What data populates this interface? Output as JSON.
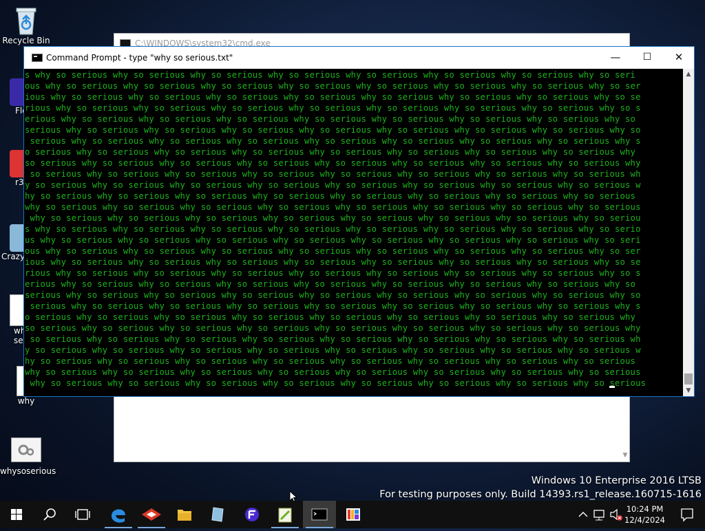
{
  "desktop": {
    "icons": [
      {
        "label": "Recycle Bin"
      },
      {
        "label": "Flo"
      },
      {
        "label": "r3"
      },
      {
        "label": "Crazy"
      },
      {
        "label": "wh"
      },
      {
        "label": "ser"
      },
      {
        "label": "why"
      },
      {
        "label": "whysoserious"
      }
    ]
  },
  "back_window": {
    "title": "C:\\WINDOWS\\system32\\cmd.exe"
  },
  "cmd_window": {
    "title": "Command Prompt - type  \"why so serious.txt\"",
    "controls": {
      "minimize": "—",
      "maximize": "☐",
      "close": "✕"
    },
    "console_lines": [
      "s why so serious why so serious why so serious why so serious why so serious why so serious why so serious why so seri",
      "ous why so serious why so serious why so serious why so serious why so serious why so serious why so serious why so ser",
      "ious why so serious why so serious why so serious why so serious why so serious why so serious why so serious why so se",
      "rious why so serious why so serious why so serious why so serious why so serious why so serious why so serious why so s",
      "erious why so serious why so serious why so serious why so serious why so serious why so serious why so serious why so",
      "serious why so serious why so serious why so serious why so serious why so serious why so serious why so serious why so",
      " serious why so serious why so serious why so serious why so serious why so serious why so serious why so serious why s",
      "o serious why so serious why so serious why so serious why so serious why so serious why so serious why so serious why",
      "so serious why so serious why so serious why so serious why so serious why so serious why so serious why so serious why",
      " so serious why so serious why so serious why so serious why so serious why so serious why so serious why so serious wh",
      "y so serious why so serious why so serious why so serious why so serious why so serious why so serious why so serious w",
      "hy so serious why so serious why so serious why so serious why so serious why so serious why so serious why so serious",
      "why so serious why so serious why so serious why so serious why so serious why so serious why so serious why so serious",
      " why so serious why so serious why so serious why so serious why so serious why so serious why so serious why so seriou",
      "s why so serious why so serious why so serious why so serious why so serious why so serious why so serious why so serio",
      "us why so serious why so serious why so serious why so serious why so serious why so serious why so serious why so seri",
      "ous why so serious why so serious why so serious why so serious why so serious why so serious why so serious why so ser",
      "ious why so serious why so serious why so serious why so serious why so serious why so serious why so serious why so se",
      "rious why so serious why so serious why so serious why so serious why so serious why so serious why so serious why so s",
      "erious why so serious why so serious why so serious why so serious why so serious why so serious why so serious why so",
      "serious why so serious why so serious why so serious why so serious why so serious why so serious why so serious why so",
      " serious why so serious why so serious why so serious why so serious why so serious why so serious why so serious why s",
      "o serious why so serious why so serious why so serious why so serious why so serious why so serious why so serious why",
      "so serious why so serious why so serious why so serious why so serious why so serious why so serious why so serious why",
      " so serious why so serious why so serious why so serious why so serious why so serious why so serious why so serious wh",
      "y so serious why so serious why so serious why so serious why so serious why so serious why so serious why so serious w",
      "hy so serious why so serious why so serious why so serious why so serious why so serious why so serious why so serious",
      "why so serious why so serious why so serious why so serious why so serious why so serious why so serious why so serious",
      " why so serious why so serious why so serious why so serious why so serious why so serious why so serious why so serious"
    ]
  },
  "watermark": {
    "line1": "Windows 10 Enterprise 2016 LTSB",
    "line2": "For testing purposes only. Build 14393.rs1_release.160715-1616"
  },
  "taskbar": {
    "apps": [
      "start",
      "search",
      "task-view",
      "edge",
      "app-red",
      "file-explorer",
      "app-tablet",
      "app-f",
      "notepad-plus",
      "cmd",
      "app-colorful"
    ],
    "clock": {
      "time": "10:24 PM",
      "date": "12/4/2024"
    }
  }
}
